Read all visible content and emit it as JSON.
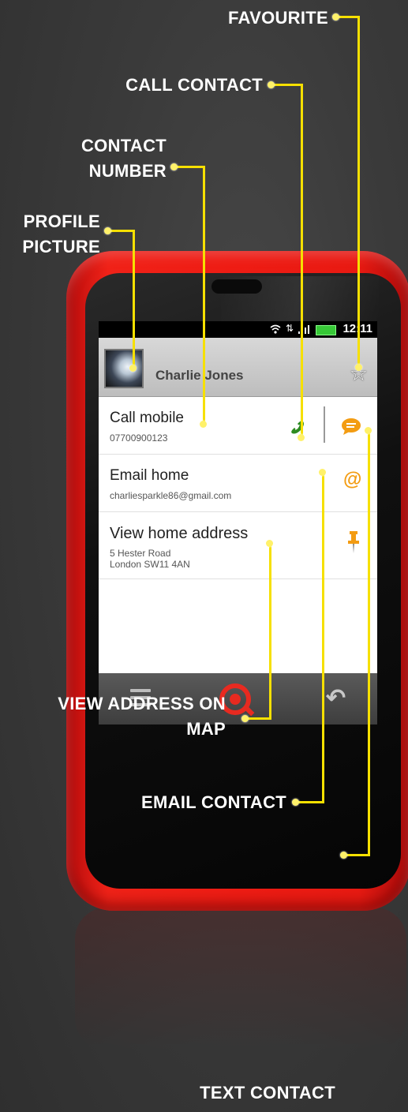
{
  "callouts": {
    "favourite": "FAVOURITE",
    "call_contact": "CALL CONTACT",
    "contact_number_1": "CONTACT",
    "contact_number_2": "NUMBER",
    "profile_picture_1": "PROFILE",
    "profile_picture_2": "PICTURE",
    "view_address_1": "VIEW ADDRESS ON",
    "view_address_2": "MAP",
    "email_contact": "EMAIL CONTACT",
    "text_contact": "TEXT CONTACT"
  },
  "status_bar": {
    "time": "12:11"
  },
  "header": {
    "name": "Charlie Jones",
    "favourite_icon": "star-icon"
  },
  "rows": {
    "call": {
      "title": "Call mobile",
      "number": "07700900123",
      "icon": "phone-icon",
      "action_icon": "message-icon"
    },
    "email": {
      "title": "Email home",
      "address": "charliesparkle86@gmail.com",
      "icon": "at-icon"
    },
    "address": {
      "title": "View home address",
      "line1": "5 Hester Road",
      "line2": "London  SW11 4AN",
      "icon": "pin-icon"
    }
  },
  "navbar": {
    "menu_icon": "menu-icon",
    "search_icon": "search-icon",
    "back_icon": "back-icon"
  },
  "colors": {
    "accent": "#f6e000",
    "phone_body": "#ee1c14",
    "icon_orange": "#f39c12",
    "icon_green": "#2e8b1f"
  }
}
